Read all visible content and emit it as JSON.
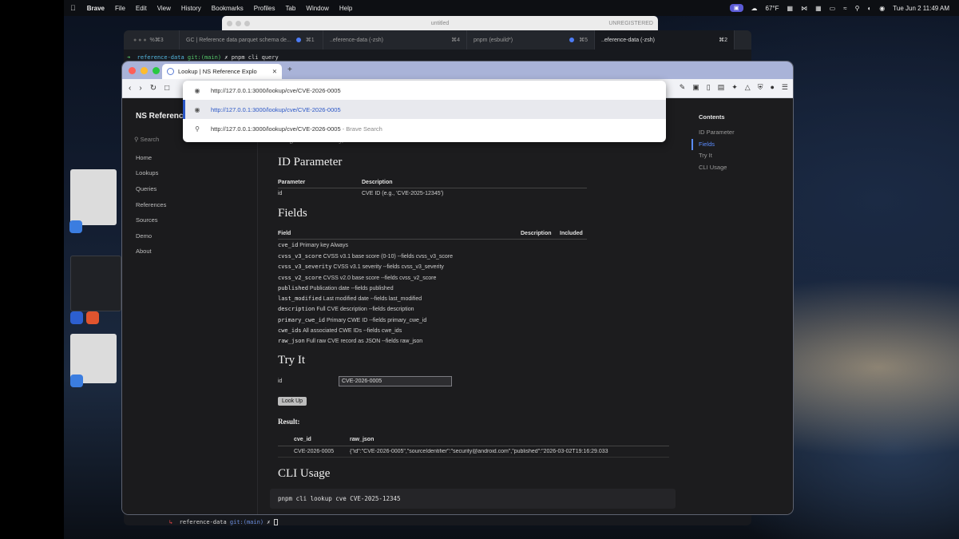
{
  "menubar": {
    "app": "Brave",
    "items": [
      "File",
      "Edit",
      "View",
      "History",
      "Bookmarks",
      "Profiles",
      "Tab",
      "Window",
      "Help"
    ],
    "weather": "67°F",
    "datetime": "Tue Jun 2  11:49 AM"
  },
  "untitled_window": {
    "title": "untitled",
    "status": "UNREGISTERED"
  },
  "terminal": {
    "tabs": [
      {
        "label": "%⌘3"
      },
      {
        "label": "GC | Reference data parquet schema de...",
        "shortcut": "⌘1"
      },
      {
        "label": "..eference-data (-zsh)",
        "shortcut": "⌘4"
      },
      {
        "label": "pnpm (esbuild*)",
        "shortcut": "⌘5"
      },
      {
        "label": "..eference-data (-zsh)",
        "shortcut": "⌘2"
      }
    ],
    "prompt_top": {
      "arrow": "➜",
      "dir": "reference-data",
      "git": "git:(main)",
      "x": "✗",
      "cmd": "pnpm cli query"
    },
    "prompt_bottom": {
      "arrow": "↳",
      "dir": "reference-data",
      "git": "git:(main)",
      "x": "✗"
    }
  },
  "browser": {
    "tab_title": "Lookup | NS Reference Explo",
    "address": "http://127.0.0.1:3000/lookup/cve/CVE-2026-0005",
    "omnibox": {
      "input": "http://127.0.0.1:3000/lookup/cve/CVE-2026-0005",
      "suggestion_selected": "http://127.0.0.1:3000/lookup/cve/CVE-2026-0005",
      "suggestion_search": "http://127.0.0.1:3000/lookup/cve/CVE-2026-0005",
      "search_suffix": "- Brave Search"
    }
  },
  "sidebar": {
    "title": "NS Reference",
    "search_placeholder": "Search",
    "items": [
      "Home",
      "Lookups",
      "Queries",
      "References",
      "Sources",
      "Demo",
      "About"
    ]
  },
  "content": {
    "categories": "Categories: Vulnerability, CVE",
    "id_parameter": {
      "heading": "ID Parameter",
      "headers": [
        "Parameter",
        "Description"
      ],
      "rows": [
        [
          "id",
          "CVE ID (e.g., 'CVE-2025-12345')"
        ]
      ]
    },
    "fields": {
      "heading": "Fields",
      "headers": [
        "Field",
        "Description",
        "Included"
      ],
      "rows": [
        [
          "cve_id",
          "Primary key",
          "Always"
        ],
        [
          "cvss_v3_score",
          "CVSS v3.1 base score (0-10)",
          "--fields cvss_v3_score"
        ],
        [
          "cvss_v3_severity",
          "CVSS v3.1 severity",
          "--fields cvss_v3_severity"
        ],
        [
          "cvss_v2_score",
          "CVSS v2.0 base score",
          "--fields cvss_v2_score"
        ],
        [
          "published",
          "Publication date",
          "--fields published"
        ],
        [
          "last_modified",
          "Last modified date",
          "--fields last_modified"
        ],
        [
          "description",
          "Full CVE description",
          "--fields description"
        ],
        [
          "primary_cwe_id",
          "Primary CWE ID",
          "--fields primary_cwe_id"
        ],
        [
          "cwe_ids",
          "All associated CWE IDs",
          "--fields cwe_ids"
        ],
        [
          "raw_json",
          "Full raw CVE record as JSON",
          "--fields raw_json"
        ]
      ]
    },
    "try_it": {
      "heading": "Try It",
      "label": "id",
      "value": "CVE-2026-0005",
      "button": "Look Up"
    },
    "result": {
      "label": "Result:",
      "headers": [
        "cve_id",
        "raw_json"
      ],
      "rows": [
        [
          "CVE-2026-0005",
          "{\"id\":\"CVE-2026-0005\",\"sourceIdentifier\":\"security@android.com\",\"published\":\"2026-03-02T19:16:29.033"
        ]
      ]
    },
    "cli": {
      "heading": "CLI Usage",
      "command": "pnpm cli lookup cve CVE-2025-12345"
    }
  },
  "toc": {
    "title": "Contents",
    "items": [
      "ID Parameter",
      "Fields",
      "Try It",
      "CLI Usage"
    ],
    "active": "Fields"
  },
  "colors": {
    "accent": "#5b8cff",
    "menubar": "#0d0f13",
    "titlebar": "#a9b3d8"
  }
}
